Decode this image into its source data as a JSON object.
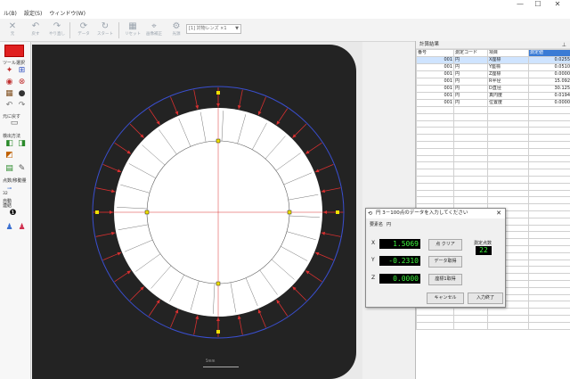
{
  "titlebar": {
    "minimize": "—",
    "maximize": "☐",
    "close": "✕"
  },
  "menu": [
    "ル(B)",
    "設定(S)",
    "ウィンドウ(W)"
  ],
  "toolbar": {
    "buttons": [
      "元",
      "戻す",
      "やり直し",
      "データ",
      "スタート",
      "リセット",
      "画像補正",
      "光源"
    ],
    "lens_select": "[1] 対物レンズ ×1"
  },
  "palette": {
    "tool_label": "ツール選択",
    "undo_label": "元に戻す",
    "method_label": "検出方法",
    "count_label": "点数/移動量",
    "auto_label": "自動",
    "spin_value": "32",
    "connect_label": "連結"
  },
  "results": {
    "title": "計算結果",
    "columns": [
      "番号",
      "測定コード",
      "項目",
      "測定値"
    ],
    "rows": [
      [
        "001",
        "円",
        "X座標",
        "0.0255"
      ],
      [
        "001",
        "円",
        "Y座標",
        "0.0510"
      ],
      [
        "001",
        "円",
        "Z座標",
        "0.0000"
      ],
      [
        "001",
        "円",
        "R半径",
        "15.092"
      ],
      [
        "001",
        "円",
        "D直径",
        "30.125"
      ],
      [
        "001",
        "円",
        "真円度",
        "0.0194"
      ],
      [
        "001",
        "円",
        "位置度",
        "0.0000"
      ]
    ],
    "empty_rows": 32
  },
  "dialog": {
    "title": "円 3－100点のデータを入力してください",
    "name_label": "要素名",
    "name_value": "円",
    "x_label": "X",
    "y_label": "Y",
    "z_label": "Z",
    "x_value": "1.5069",
    "y_value": "-0.2310",
    "z_value": "0.0000",
    "clear_button": "点 クリア",
    "data_button": "データ取得",
    "reset_button": "座標1取得",
    "count_label": "測定点数",
    "count_value": "22",
    "cancel_button": "キャンセル",
    "finish_button": "入力終了"
  },
  "viewport": {
    "scale_label": "5mm"
  },
  "colors": {
    "palette_red": "#e02020",
    "vector_red": "#d83030",
    "ring_blue": "#3a4fd0",
    "marker_yellow": "#f0e000",
    "lcd_green": "#3ef43e",
    "grid_highlight": "#3a7bd5"
  }
}
